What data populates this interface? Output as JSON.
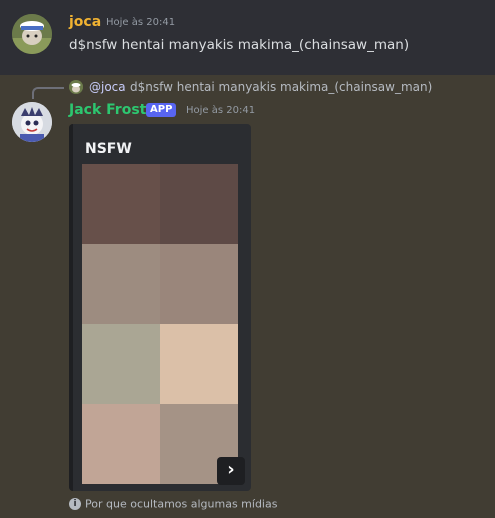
{
  "message1": {
    "username": "joca",
    "timestamp": "Hoje às 20:41",
    "content": "d$nsfw hentai manyakis makima_(chainsaw_man)"
  },
  "reply": {
    "mention": "@joca",
    "text": "d$nsfw hentai manyakis makima_(chainsaw_man)"
  },
  "message2": {
    "username": "Jack Frost",
    "badge": "APP",
    "timestamp": "Hoje às 20:41"
  },
  "embed": {
    "title": "NSFW",
    "next_glyph": "›",
    "cells": [
      {
        "color": "#67504a"
      },
      {
        "color": "#5e4a46"
      },
      {
        "color": "#9d8c80"
      },
      {
        "color": "#9a867b"
      },
      {
        "color": "#aaa694"
      },
      {
        "color": "#dbc0a8"
      },
      {
        "color": "#c1a596"
      },
      {
        "color": "#a59386"
      }
    ]
  },
  "info": {
    "icon": "i",
    "text": "Por que ocultamos algumas mídias"
  },
  "colors": {
    "background": "#413d33",
    "username1": "#f0b232",
    "username2": "#2dc770",
    "badge": "#5865f2"
  }
}
